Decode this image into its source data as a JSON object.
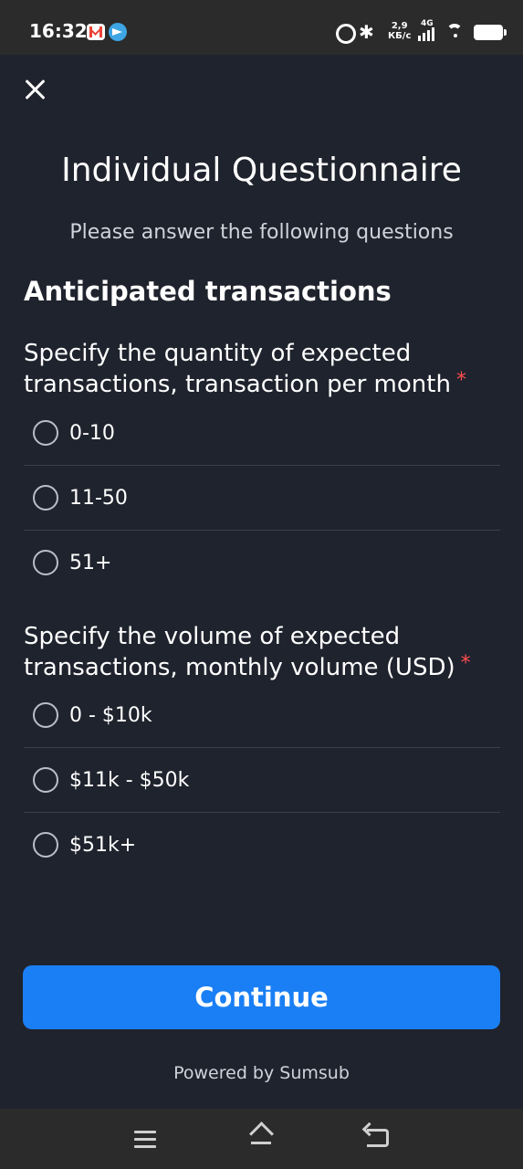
{
  "status_bar": {
    "time": "16:32",
    "net_speed_value": "2,9",
    "net_speed_unit": "КБ/с",
    "network_type": "4G",
    "icons": [
      "gmail-icon",
      "telegram-icon",
      "alarm-icon",
      "bluetooth-icon",
      "signal-icon",
      "wifi-icon",
      "battery-icon"
    ]
  },
  "header": {
    "title": "Individual Questionnaire",
    "subtitle": "Please answer the following questions"
  },
  "section": {
    "title": "Anticipated transactions"
  },
  "questions": [
    {
      "label": "Specify the quantity of expected transactions, transaction per month",
      "required_mark": "*",
      "options": [
        "0-10",
        "11-50",
        "51+"
      ]
    },
    {
      "label": "Specify the volume of expected transactions, monthly volume (USD)",
      "required_mark": "*",
      "options": [
        "0 - $10k",
        "$11k - $50k",
        "$51k+"
      ]
    }
  ],
  "actions": {
    "continue_label": "Continue"
  },
  "footer": {
    "powered_by": "Powered by Sumsub"
  },
  "colors": {
    "background": "#1f232d",
    "accent": "#1a7ff4",
    "required": "#ff4d4f"
  }
}
